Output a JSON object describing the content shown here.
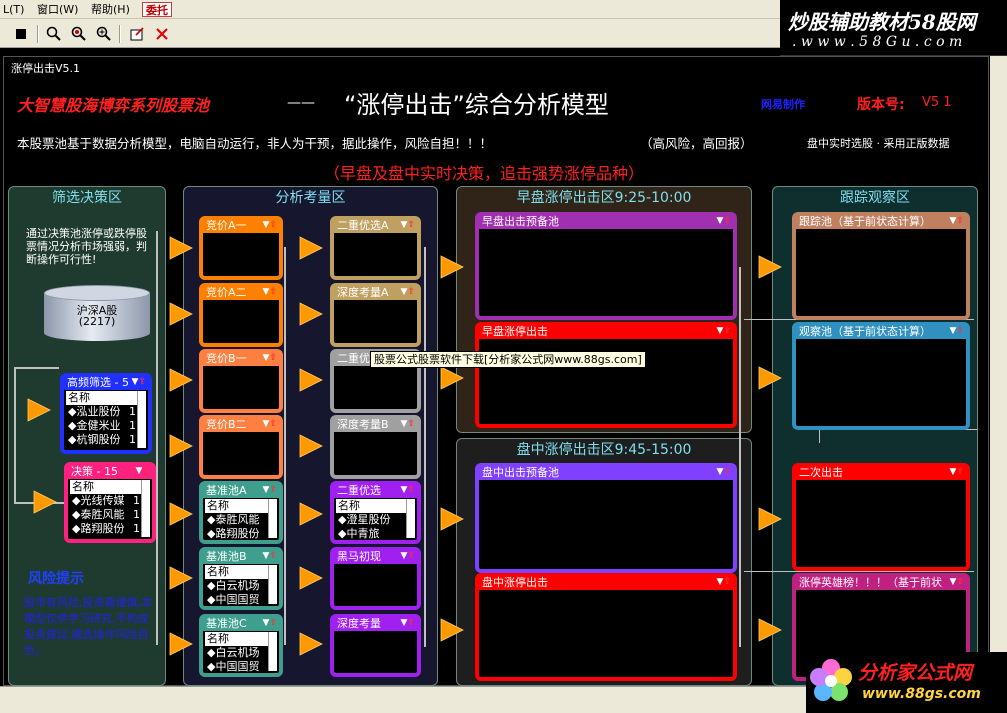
{
  "menu": {
    "items": [
      "L(T)",
      "窗口(W)",
      "帮助(H)",
      "委托"
    ]
  },
  "toolbar": {
    "icons": [
      "stop-icon",
      "find-icon",
      "refresh-search-icon",
      "zoom-icon",
      "window-icon",
      "close-icon"
    ]
  },
  "watermark_top": {
    "line1": "炒股辅助教材58股网",
    "line2": ". w w w . 5 8 G u . c o m"
  },
  "watermark_bottom": {
    "brand": "分析家公式网",
    "url": "www.88gs.com"
  },
  "window": {
    "title": "涨停出击V5.1"
  },
  "header": {
    "series": "大智慧股海博弈系列股票池",
    "dash": "——",
    "main_title": "“涨停出击”综合分析模型",
    "maker": "网易制作",
    "version_label": "版本号:",
    "version": "V5 1",
    "disclaimer": "本股票池基于数据分析模型，电脑自动运行，非人为干预，据此操作，风险自担！！！",
    "risk": "（高风险，高回报）",
    "realtime": "盘中实时选股 · 采用正版数据",
    "subtitle": "（早盘及盘中实时决策，追击强势涨停品种）"
  },
  "zones": {
    "screen": "筛选决策区",
    "analysis": "分析考量区",
    "morning": "早盘涨停出击区9:25-10:00",
    "intraday": "盘中涨停出击区9:45-15:00",
    "track": "跟踪观察区"
  },
  "screen_note": "通过决策池涨停或跌停股票情况分析市场强弱，判断操作可行性!",
  "hs_pool": {
    "label": "沪深A股",
    "count": "(2217)"
  },
  "warning": {
    "title": "风险提示",
    "text": "股市有风险,投资需谨慎,本模型仅供学习研究,不构成投资建议,据此操作风险自负。"
  },
  "pools": {
    "gaopin": {
      "title": "高频筛选 - 5",
      "col": "名称",
      "rows": [
        {
          "name": "◆泓业股份",
          "v": "1"
        },
        {
          "name": "◆金健米业",
          "v": "1"
        },
        {
          "name": "◆杭钢股份",
          "v": "1"
        }
      ]
    },
    "juece": {
      "title": "决策 - 15",
      "col": "名称",
      "rows": [
        {
          "name": "◆光线传媒",
          "v": "1"
        },
        {
          "name": "◆泰胜风能",
          "v": "1"
        },
        {
          "name": "◆路翔股份",
          "v": "1"
        }
      ]
    },
    "jingjiaA1": {
      "title": "竞价A一"
    },
    "jingjiaA2": {
      "title": "竞价A二"
    },
    "jingjiaB1": {
      "title": "竞价B一"
    },
    "jingjiaB2": {
      "title": "竞价B二"
    },
    "jizhunA": {
      "title": "基准池A",
      "col": "名称",
      "rows": [
        "◆泰胜风能",
        "◆路翔股份"
      ]
    },
    "jizhunB": {
      "title": "基准池B",
      "col": "名称",
      "rows": [
        "◆白云机场",
        "◆中国国贸"
      ]
    },
    "jizhunC": {
      "title": "基准池C",
      "col": "名称",
      "rows": [
        "◆白云机场",
        "◆中国国贸"
      ]
    },
    "erchongA": {
      "title": "二重优选A"
    },
    "shenduA": {
      "title": "深度考量A"
    },
    "erchongB": {
      "title": "二重优选B"
    },
    "shenduB": {
      "title": "深度考量B"
    },
    "erchong": {
      "title": "二重优选",
      "col": "名称",
      "rows": [
        "◆澄星股份",
        "◆中青旅"
      ]
    },
    "heima": {
      "title": "黑马初现"
    },
    "shendu": {
      "title": "深度考量"
    },
    "zaopan_pre": {
      "title": "早盘出击预备池"
    },
    "zaopan_zt": {
      "title": "早盘涨停出击"
    },
    "panzhong_pre": {
      "title": "盘中出击预备池"
    },
    "panzhong_zt": {
      "title": "盘中涨停出击"
    },
    "genzong": {
      "title": "跟踪池（基于前状态计算）"
    },
    "guancha": {
      "title": "观察池（基于前状态计算）"
    },
    "erci": {
      "title": "二次出击"
    },
    "yingxiong": {
      "title": "涨停英雄榜！！！（基于前状"
    }
  },
  "tooltip": "股票公式股票软件下载[分析家公式网www.88gs.com]",
  "colors": {
    "orange": "#ff8000",
    "red": "#ff0000",
    "purple": "#a020f0",
    "teal": "#3f9f8f",
    "tan": "#c0a060",
    "gray": "#a0a0a0",
    "blue_list": "#2030ff",
    "pink": "#ff2080",
    "violet": "#8040ff",
    "brown": "#c08060",
    "sky": "#3090c0",
    "yellow_title": "#ffff00"
  }
}
